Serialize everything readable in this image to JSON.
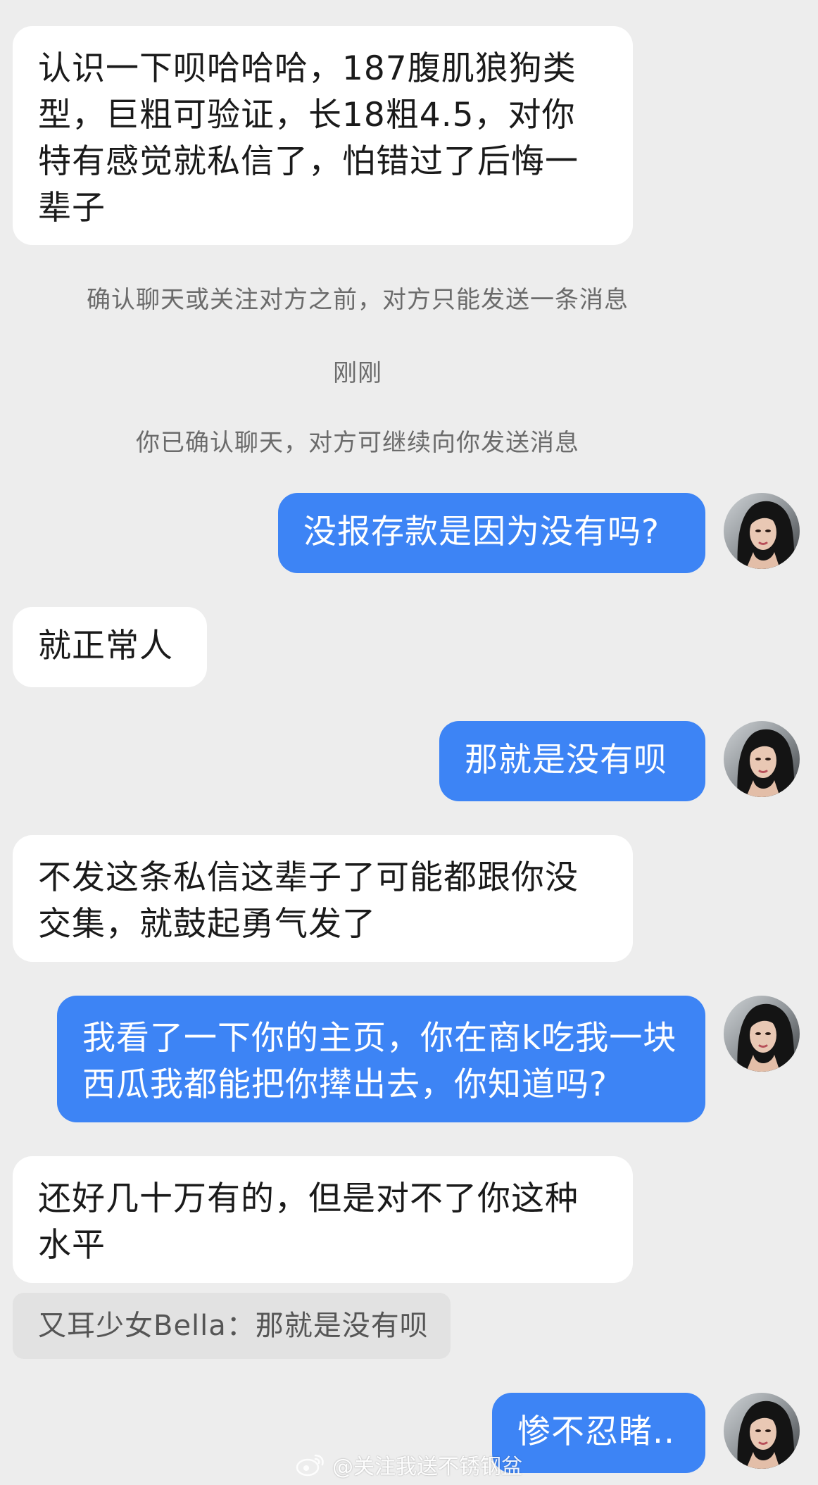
{
  "conversation": {
    "messages": [
      {
        "text": "认识一下呗哈哈哈，187腹肌狼狗类型，巨粗可验证，长18粗4.5，对你特有感觉就私信了，怕错过了后悔一辈子"
      },
      {
        "text": "没报存款是因为没有吗?"
      },
      {
        "text": "就正常人"
      },
      {
        "text": "那就是没有呗"
      },
      {
        "text": "不发这条私信这辈子了可能都跟你没交集，就鼓起勇气发了"
      },
      {
        "text": "我看了一下你的主页，你在商k吃我一块西瓜我都能把你撵出去，你知道吗?"
      },
      {
        "text": "还好几十万有的，但是对不了你这种水平"
      },
      {
        "text": "惨不忍睹.."
      }
    ],
    "system_notices": {
      "restriction": "确认聊天或关注对方之前，对方只能发送一条消息",
      "timestamp": "刚刚",
      "confirmed": "你已确认聊天，对方可继续向你发送消息"
    },
    "quote": "又耳少女Bella：那就是没有呗"
  },
  "watermark": {
    "text": "@关注我送不锈钢盆",
    "icon": "weibo-logo-icon"
  },
  "colors": {
    "background": "#ededed",
    "incoming_bubble": "#ffffff",
    "outgoing_bubble": "#3d84f5",
    "system_text": "#6b6b6b"
  }
}
